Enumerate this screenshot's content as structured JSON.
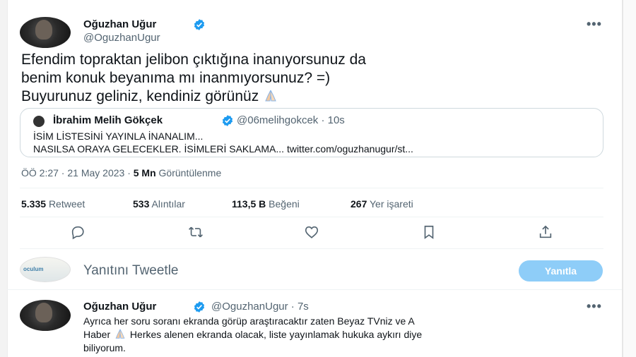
{
  "tweet": {
    "author_name": "Oğuzhan Uğur",
    "author_handle": "@OguzhanUgur",
    "more_label": "•••",
    "text_lines": [
      "Efendim topraktan jelibon çıktığına inanıyorsunuz da",
      "benim konuk beyanıma mı inanmıyorsunuz? =)",
      "Buyurunuz geliniz, kendiniz görünüz"
    ],
    "text_emoji": "folded-hands-emoji",
    "quote": {
      "name": "İbrahim Melih Gökçek",
      "handle_time": "@06melihgokcek · 10s",
      "line1": "İSİM LİSTESİNİ YAYINLA İNANALIM...",
      "line2": "NASILSA ORAYA GELECEKLER. İSİMLERİ SAKLAMA... twitter.com/oguzhanugur/st..."
    },
    "timestamp": "ÖÖ 2:27 · 21 May 2023 · ",
    "views_count": "5 Mn",
    "views_label": "Görüntülenme",
    "stats": {
      "retweets_count": "5.335",
      "retweets_label": "Retweet",
      "quotes_count": "533",
      "quotes_label": "Alıntılar",
      "likes_count": "113,5 B",
      "likes_label": "Beğeni",
      "bookmarks_count": "267",
      "bookmarks_label": "Yer işareti"
    }
  },
  "actions": [
    "reply-icon",
    "retweet-icon",
    "like-icon",
    "bookmark-icon",
    "share-icon"
  ],
  "compose": {
    "avatar_text": "oculum",
    "placeholder": "Yanıtını Tweetle",
    "button_label": "Yanıtla"
  },
  "reply": {
    "author_name": "Oğuzhan Uğur",
    "handle_time": "@OguzhanUgur · 7s",
    "more_label": "•••",
    "text_line1": "Ayrıca her soru soranı ekranda görüp araştıracaktır zaten Beyaz TVniz ve A",
    "text_line2a": "Haber",
    "text_line2b": "Herkes alenen ekranda olacak, liste yayınlamak hukuka aykırı diye",
    "text_line3": "biliyorum."
  },
  "colors": {
    "verified_blue": "#1d9bf0",
    "secondary_text": "#536471",
    "reply_button": "#8ecdf8",
    "border": "#cfd9de"
  }
}
